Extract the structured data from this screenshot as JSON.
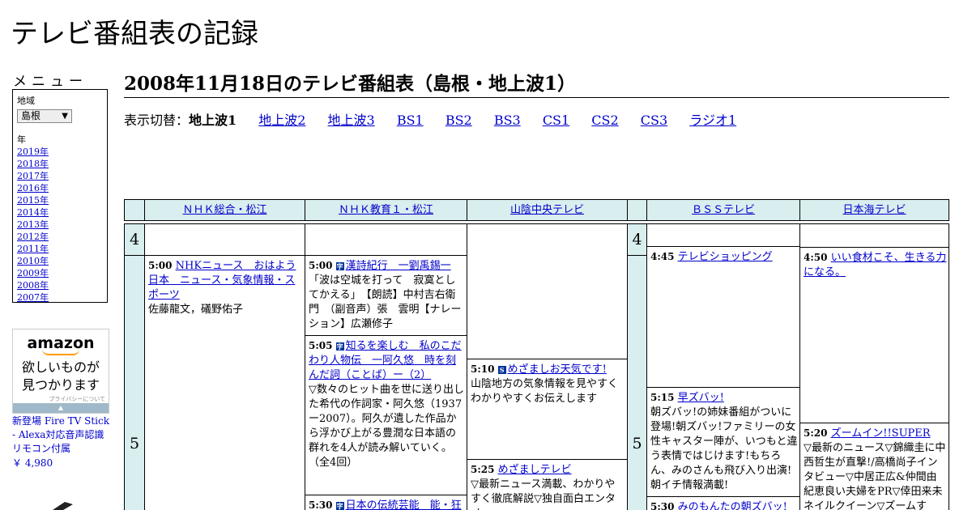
{
  "site_title": "テレビ番組表の記録",
  "menu": {
    "label": "メニュー",
    "region_label": "地域",
    "region_value": "島根",
    "year_label": "年",
    "years": [
      "2019年",
      "2018年",
      "2017年",
      "2016年",
      "2015年",
      "2014年",
      "2013年",
      "2012年",
      "2011年",
      "2010年",
      "2009年",
      "2008年",
      "2007年"
    ]
  },
  "ad": {
    "logo": "amazon",
    "copy_line1": "欲しいものが",
    "copy_line2": "見つかります",
    "privacy": "プライバシーについて",
    "caption": "新登場 Fire TV Stick - Alexa対応音声認識リモコン付属",
    "price": "￥ 4,980"
  },
  "page_title": "2008年11月18日のテレビ番組表（島根・地上波1）",
  "switcher": {
    "label": "表示切替：",
    "current": "地上波1",
    "links": [
      "地上波2",
      "地上波3",
      "BS1",
      "BS2",
      "BS3",
      "CS1",
      "CS2",
      "CS3",
      "ラジオ1"
    ]
  },
  "channels": [
    "ＮＨＫ総合・松江",
    "ＮＨＫ教育１・松江",
    "山陰中央テレビ",
    "ＢＳＳテレビ",
    "日本海テレビ"
  ],
  "hours": [
    "4",
    "5"
  ],
  "programs": {
    "nhk1_0500": {
      "time": "5:00",
      "title": "NHKニュース　おはよう日本　ニュース・気象情報・スポーツ",
      "desc": "佐藤龍文，礒野佑子"
    },
    "nhke_0500": {
      "time": "5:00",
      "icon": "字",
      "title": "漢詩紀行　一劉禹錫一",
      "desc": "「波は空城を打って　寂寞としてかえる」　【朗読】中村吉右衛門　（副音声）張　雲明【ナレーション】広瀬修子"
    },
    "nhke_0505": {
      "time": "5:05",
      "icon": "字",
      "title": "知るを楽しむ　私のこだわり人物伝　一阿久悠　時を刻んだ詞（ことば）ー（2）",
      "desc": "▽数々のヒット曲を世に送り出した希代の作詞家・阿久悠（1937ー2007）。阿久が遺した作品から浮かび上がる豊潤な日本語の群れを4人が読み解いていく。（全4回）"
    },
    "nhke_0530": {
      "time": "5:30",
      "icon": "字",
      "title": "日本の伝統芸能　能・狂言",
      "desc": ""
    },
    "tsk_0510": {
      "time": "5:10",
      "icon": "S",
      "title": "めざましお天気です!",
      "desc": "山陰地方の気象情報を見やすくわかりやすくお伝えします"
    },
    "tsk_0525": {
      "time": "5:25",
      "title": "めざましテレビ",
      "desc": "▽最新ニュース満載、わかりやすく徹底解説▽独自面白エンタメ"
    },
    "bss_0445": {
      "time": "4:45",
      "title": "テレビショッピング",
      "desc": ""
    },
    "bss_0515": {
      "time": "5:15",
      "title": "早ズバッ!",
      "desc": "朝ズバッ!の姉妹番組がついに登場!朝ズバッ!ファミリーの女性キャスター陣が、いつもと違う表情ではじけます!もちろん、みのさんも飛び入り出演!朝イチ情報満載!"
    },
    "bss_0530": {
      "time": "5:30",
      "title": "みのもんたの朝ズバッ!",
      "desc": ""
    },
    "ntv_0450": {
      "time": "4:50",
      "title": "いい食材こそ、生きる力になる。",
      "desc": ""
    },
    "ntv_0520": {
      "time": "5:20",
      "title": "ズームイン!!SUPER",
      "desc": "▽最新のニュース▽錦織圭に中西哲生が直撃!/高橋尚子インタビュー▽中居正広&仲間由紀恵良い夫婦をPR▽倖田来未ネイルクイーン▽ズームす"
    }
  }
}
